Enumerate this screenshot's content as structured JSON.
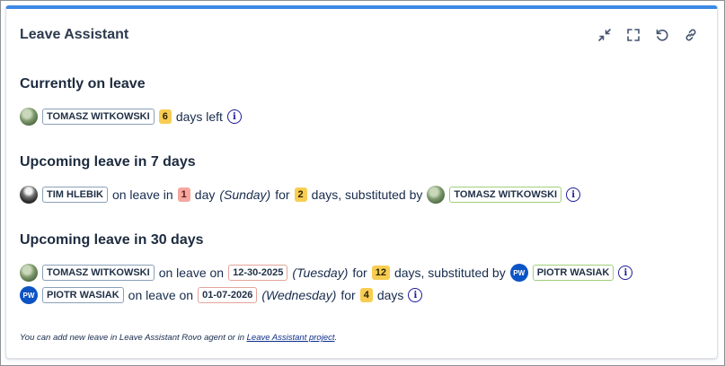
{
  "app": {
    "title": "Leave Assistant"
  },
  "toolbar": {
    "icons": [
      "collapse-icon",
      "fullscreen-icon",
      "refresh-icon",
      "link-icon"
    ]
  },
  "sections": {
    "current": {
      "title": "Currently on leave",
      "row": {
        "name": "TOMASZ WITKOWSKI",
        "days": "6",
        "suffix": "days left"
      }
    },
    "week": {
      "title": "Upcoming leave in 7 days",
      "row": {
        "name": "TIM HLEBIK",
        "text_on_leave_in": "on leave in",
        "in_days": "1",
        "text_day": "day",
        "weekday": "(Sunday)",
        "text_for": "for",
        "days": "2",
        "text_days_sub": "days, substituted by",
        "substitute": "TOMASZ WITKOWSKI"
      }
    },
    "month": {
      "title": "Upcoming leave in 30 days",
      "rows": [
        {
          "name": "TOMASZ WITKOWSKI",
          "text_on_leave_on": "on leave on",
          "date": "12-30-2025",
          "weekday": "(Tuesday)",
          "text_for": "for",
          "days": "12",
          "text_days_sub": "days, substituted by",
          "substitute_initials": "PW",
          "substitute": "PIOTR WASIAK"
        },
        {
          "initials": "PW",
          "name": "PIOTR WASIAK",
          "text_on_leave_on": "on leave on",
          "date": "01-07-2026",
          "weekday": "(Wednesday)",
          "text_for": "for",
          "days": "4",
          "text_days": "days"
        }
      ]
    }
  },
  "footnote": {
    "prefix": "You can add new leave in Leave Assistant Rovo agent or in ",
    "link": "Leave Assistant project",
    "suffix": "."
  },
  "colors": {
    "accent_top_border": "#3d8ae6",
    "badge_yellow": "#f8cd52",
    "badge_red": "#f6a7a0",
    "initials_avatar": "#0c53c4",
    "info_icon": "#1c1a9c"
  }
}
